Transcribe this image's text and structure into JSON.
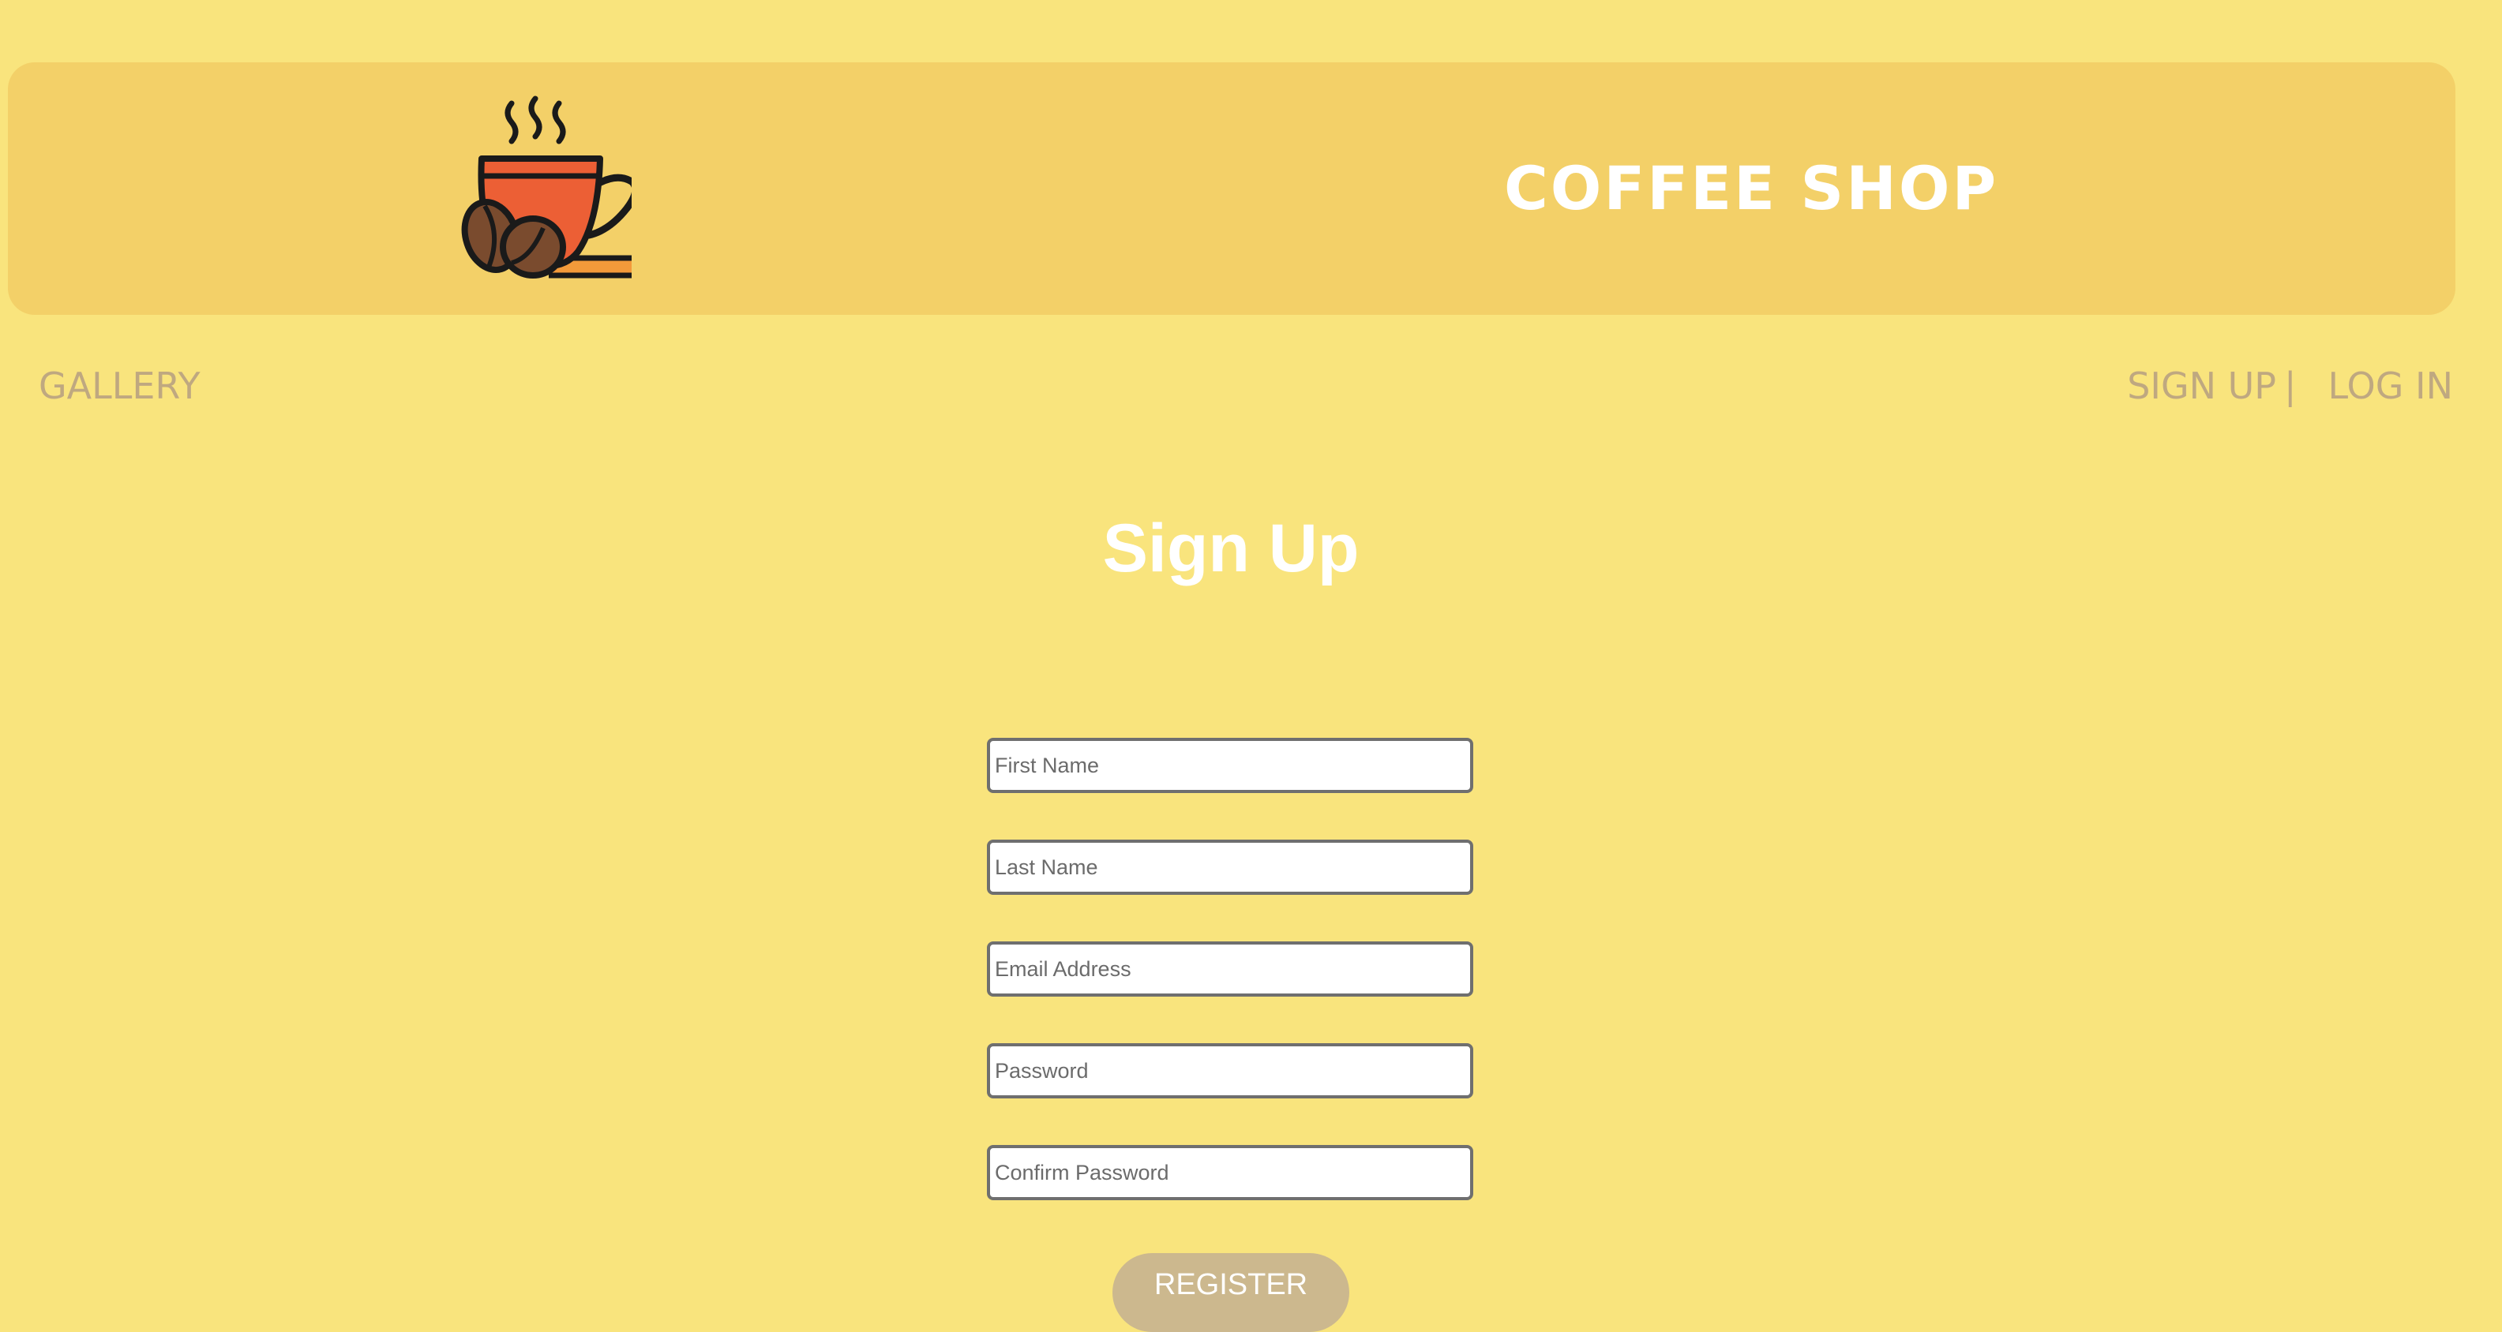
{
  "header": {
    "logo_icon": "coffee-cup-with-beans-icon",
    "brand": "COFFEE SHOP"
  },
  "nav": {
    "gallery": "GALLERY",
    "signup": "SIGN UP",
    "separator": "|",
    "login": "LOG IN"
  },
  "form": {
    "title": "Sign Up",
    "first_name_placeholder": "First Name",
    "last_name_placeholder": "Last Name",
    "email_placeholder": "Email Address",
    "password_placeholder": "Password",
    "confirm_password_placeholder": "Confirm Password",
    "submit_label": "REGISTER"
  },
  "colors": {
    "background": "#f9e47d",
    "header_background": "#f3d068",
    "nav_text": "#bfa880",
    "button": "#ccb88e",
    "cup": "#ec5f35",
    "beans": "#7a4b2e"
  }
}
